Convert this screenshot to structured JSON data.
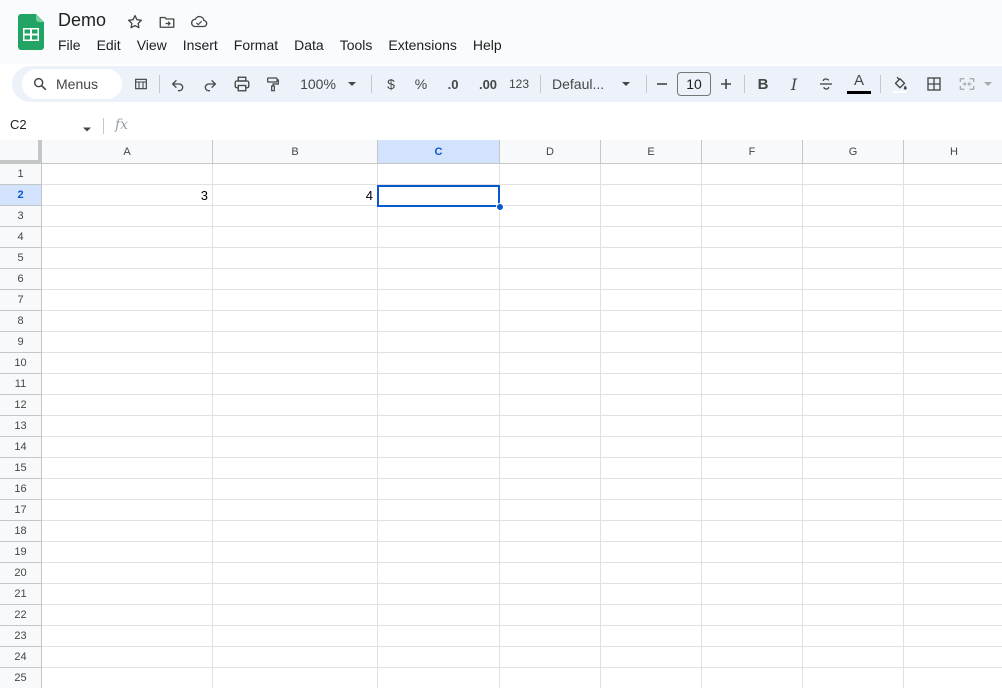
{
  "app": {
    "doc_title": "Demo",
    "icons": [
      "sheets-logo-icon",
      "star-icon",
      "move-to-folder-icon",
      "cloud-saved-icon"
    ],
    "brand_color": "#188038"
  },
  "menu": [
    "File",
    "Edit",
    "View",
    "Insert",
    "Format",
    "Data",
    "Tools",
    "Extensions",
    "Help"
  ],
  "toolbar": {
    "search_label": "Menus",
    "zoom": "100%",
    "currency": "$",
    "percent": "%",
    "decrease_decimal": ".0",
    "increase_decimal": ".00",
    "number_format": "123",
    "font_family": "Defaul...",
    "font_size": "10",
    "bold": "B",
    "italic": "I",
    "text_color_letter": "A"
  },
  "formula_bar": {
    "cell_ref": "C2",
    "fx": "fx",
    "content": ""
  },
  "grid": {
    "columns": [
      "A",
      "B",
      "C",
      "D",
      "E",
      "F",
      "G",
      "H"
    ],
    "selected_column": "C",
    "rows": [
      "1",
      "2",
      "3",
      "4",
      "5",
      "6",
      "7",
      "8",
      "9",
      "10",
      "11",
      "12",
      "13",
      "14",
      "15",
      "16",
      "17",
      "18",
      "19",
      "20",
      "21",
      "22",
      "23",
      "24",
      "25"
    ],
    "selected_row": "2",
    "cells": {
      "A2": "3",
      "B2": "4"
    },
    "selection_color": "#0b57d0"
  }
}
